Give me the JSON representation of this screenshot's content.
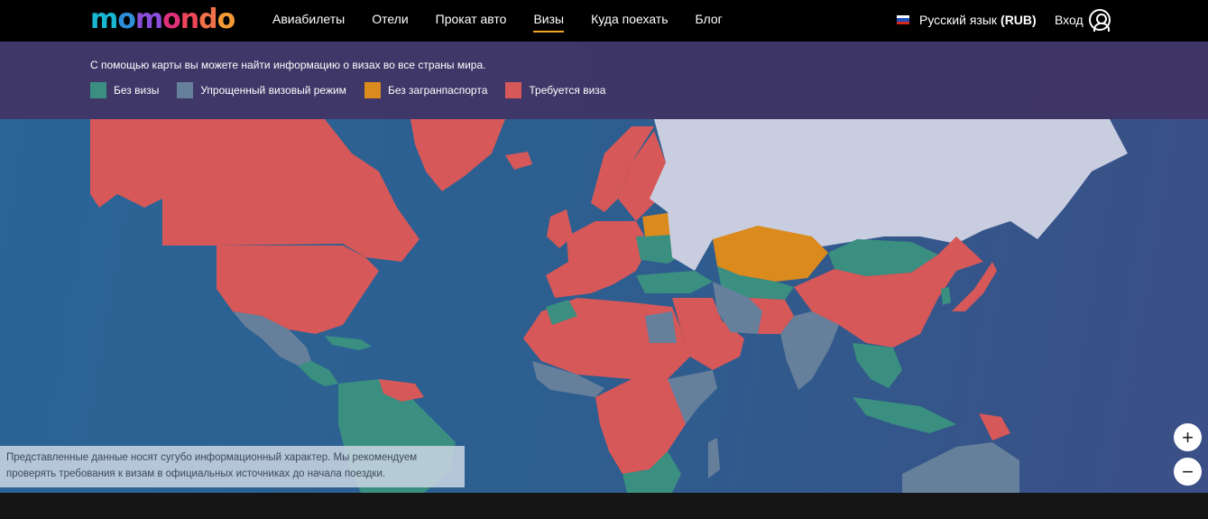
{
  "nav": {
    "logo": [
      "m",
      "o",
      "m",
      "o",
      "n",
      "d",
      "o"
    ],
    "links": [
      "Авиабилеты",
      "Отели",
      "Прокат авто",
      "Визы",
      "Куда поехать",
      "Блог"
    ],
    "active_index": 3,
    "language_label": "Русский язык",
    "currency": "(RUB)",
    "login_label": "Вход",
    "flag_colors": [
      "#ffffff",
      "#1f4dbb",
      "#d52b1e"
    ]
  },
  "legend": {
    "intro": "С помощью карты вы можете найти информацию о визах во все страны мира.",
    "items": [
      {
        "label": "Без визы",
        "color": "#3a8f80"
      },
      {
        "label": "Упрощенный визовый режим",
        "color": "#667f9b"
      },
      {
        "label": "Без загранпаспорта",
        "color": "#db8a1e"
      },
      {
        "label": "Требуется виза",
        "color": "#d65858"
      }
    ]
  },
  "map": {
    "home_country_color": "#c8cde0",
    "ocean_color": "#2d5e8f"
  },
  "disclaimer": {
    "line1": "Представленные данные носят сугубо информационный характер. Мы рекомендуем",
    "line2": "проверять требования к визам в официальных источниках до начала поездки."
  },
  "zoom": {
    "in_symbol": "+",
    "out_symbol": "−"
  }
}
